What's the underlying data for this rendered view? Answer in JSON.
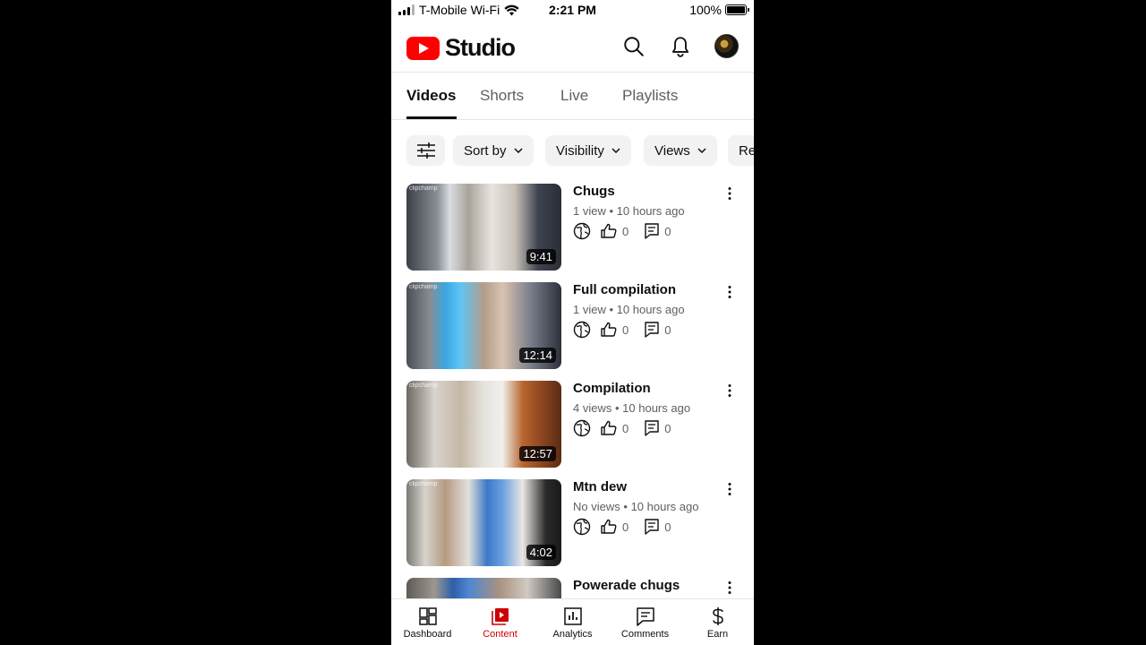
{
  "status_bar": {
    "carrier": "T-Mobile Wi-Fi",
    "time": "2:21 PM",
    "battery": "100%",
    "battery_level": 1.0
  },
  "header": {
    "logo_text": "Studio",
    "icons": [
      "search-icon",
      "bell-icon",
      "avatar"
    ]
  },
  "tabs": [
    {
      "label": "Videos",
      "active": true
    },
    {
      "label": "Shorts",
      "active": false
    },
    {
      "label": "Live",
      "active": false
    },
    {
      "label": "Playlists",
      "active": false
    }
  ],
  "filters": {
    "filter_icon": "sliders-icon",
    "chips": [
      {
        "label": "Sort by"
      },
      {
        "label": "Visibility"
      },
      {
        "label": "Views"
      },
      {
        "label": "Re"
      }
    ]
  },
  "videos": [
    {
      "title": "Chugs",
      "views": "1 view",
      "age": "10 hours ago",
      "likes": "0",
      "comments": "0",
      "duration": "9:41",
      "thumb_brand": "clipchamp"
    },
    {
      "title": "Full compilation",
      "views": "1 view",
      "age": "10 hours ago",
      "likes": "0",
      "comments": "0",
      "duration": "12:14",
      "thumb_brand": "clipchamp"
    },
    {
      "title": "Compilation",
      "views": "4 views",
      "age": "10 hours ago",
      "likes": "0",
      "comments": "0",
      "duration": "12:57",
      "thumb_brand": "clipchamp"
    },
    {
      "title": "Mtn dew",
      "views": "No views",
      "age": "10 hours ago",
      "likes": "0",
      "comments": "0",
      "duration": "4:02",
      "thumb_brand": "clipchamp"
    },
    {
      "title": "Powerade chugs",
      "views": "",
      "age": "",
      "likes": "",
      "comments": "",
      "duration": "",
      "thumb_brand": ""
    }
  ],
  "meta_separator": "•",
  "bottom_nav": [
    {
      "label": "Dashboard",
      "icon": "dashboard-icon",
      "active": false
    },
    {
      "label": "Content",
      "icon": "content-icon",
      "active": true
    },
    {
      "label": "Analytics",
      "icon": "analytics-icon",
      "active": false
    },
    {
      "label": "Comments",
      "icon": "comments-icon",
      "active": false
    },
    {
      "label": "Earn",
      "icon": "dollar-icon",
      "active": false
    }
  ],
  "colors": {
    "brand_red": "#ff0000",
    "active_nav": "#cc0000",
    "text_primary": "#0f0f0f",
    "text_secondary": "#606060",
    "chip_bg": "#f2f2f2"
  }
}
